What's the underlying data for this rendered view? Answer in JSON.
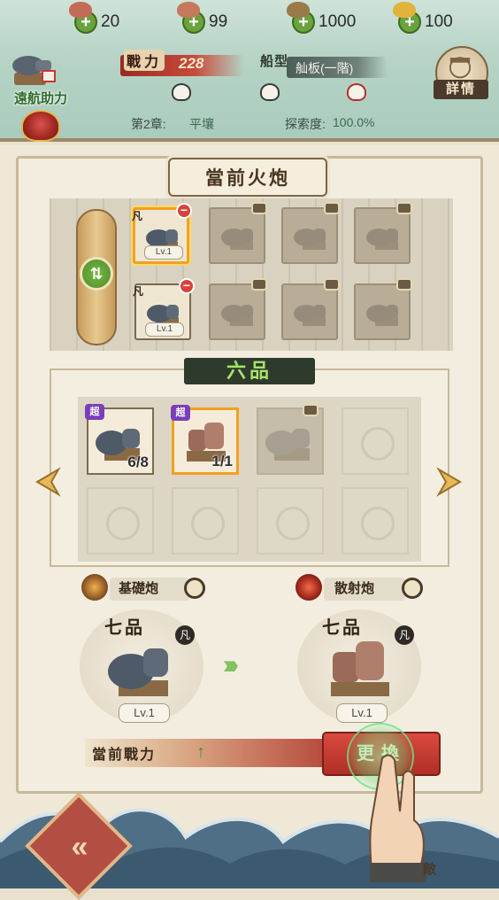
{
  "resources": [
    {
      "icon": "meat-icon",
      "value": "20",
      "color": "#c46a58"
    },
    {
      "icon": "fish-icon",
      "value": "99",
      "color": "#c47a5a"
    },
    {
      "icon": "wood-icon",
      "value": "1000",
      "color": "#9a7a4a"
    },
    {
      "icon": "gold-icon",
      "value": "100",
      "color": "#e0b43a"
    }
  ],
  "assist": {
    "label": "遠航助力"
  },
  "stats": {
    "power_label": "戰力",
    "power_value": "228",
    "ship_label": "船型",
    "ship_value": "舢板(一階)"
  },
  "chapter": {
    "chapter": "第2章:",
    "place": "平壤",
    "explore_label": "探索度:",
    "explore_value": "100.0%"
  },
  "details_label": "詳情",
  "current_cannon_title": "當前火炮",
  "equipped": {
    "row1": [
      {
        "state": "filled",
        "rarity": "凡",
        "level": "Lv.1",
        "selected": true
      },
      {
        "state": "locked"
      },
      {
        "state": "locked"
      },
      {
        "state": "locked"
      }
    ],
    "row2": [
      {
        "state": "filled",
        "rarity": "凡",
        "level": "Lv.1",
        "selected": false
      },
      {
        "state": "locked"
      },
      {
        "state": "locked"
      },
      {
        "state": "locked"
      }
    ]
  },
  "grade_title": "六品",
  "inventory": [
    {
      "state": "item",
      "tag": "超",
      "count": "6/8",
      "type": "iron"
    },
    {
      "state": "item",
      "tag": "超",
      "count": "1/1",
      "type": "scatter",
      "selected": true
    },
    {
      "state": "locked"
    },
    {
      "state": "empty"
    },
    {
      "state": "empty"
    },
    {
      "state": "empty"
    },
    {
      "state": "empty"
    },
    {
      "state": "empty"
    }
  ],
  "compare": {
    "left": {
      "type_label": "基礎炮",
      "grade": "七品",
      "rarity": "凡",
      "level": "Lv.1"
    },
    "right": {
      "type_label": "散射炮",
      "grade": "七品",
      "rarity": "凡",
      "level": "Lv.1"
    },
    "arrows": "›››"
  },
  "current_power_label": "當前戰力",
  "swap_button": "更換",
  "back_icon": "«",
  "corner_label": "敵"
}
